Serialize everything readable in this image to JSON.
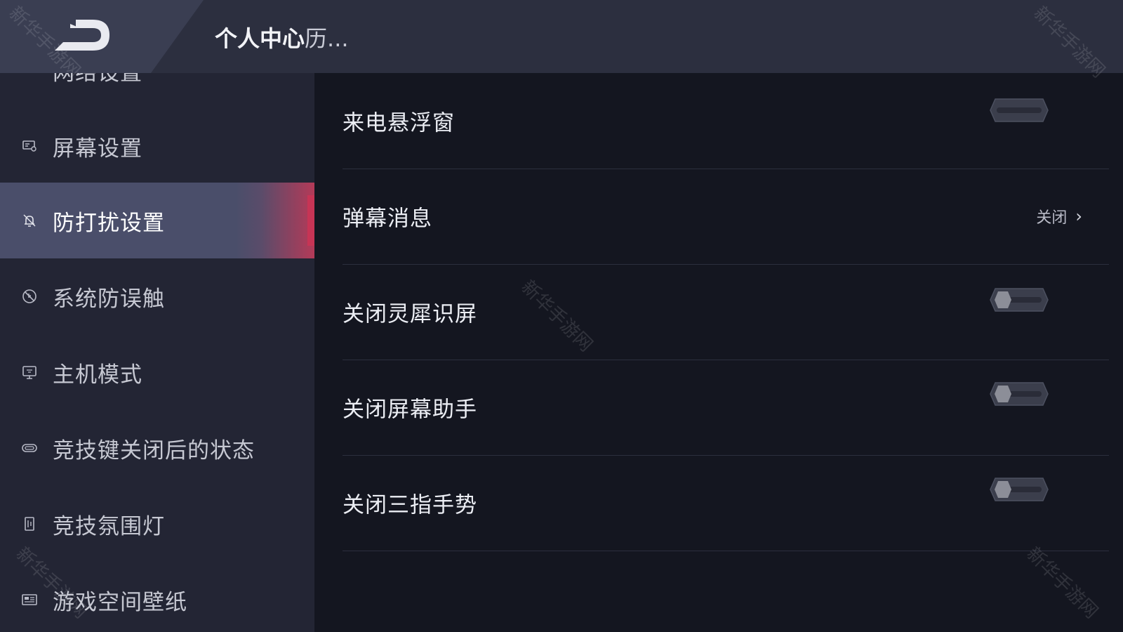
{
  "header": {
    "title_main": "个人中心",
    "title_sub": "历...",
    "back_icon": "back-arrow-icon"
  },
  "sidebar": {
    "items": [
      {
        "label": "网络设置",
        "icon": "network-icon"
      },
      {
        "label": "屏幕设置",
        "icon": "screen-settings-icon"
      },
      {
        "label": "防打扰设置",
        "icon": "bell-off-icon",
        "active": true
      },
      {
        "label": "系统防误触",
        "icon": "no-touch-icon"
      },
      {
        "label": "主机模式",
        "icon": "monitor-icon"
      },
      {
        "label": "竞技键关闭后的状态",
        "icon": "game-key-icon"
      },
      {
        "label": "竞技氛围灯",
        "icon": "light-icon"
      },
      {
        "label": "游戏空间壁纸",
        "icon": "wallpaper-icon"
      }
    ]
  },
  "settings": [
    {
      "label": "来电悬浮窗",
      "type": "toggle",
      "state": "off-no-knob"
    },
    {
      "label": "弹幕消息",
      "type": "link",
      "value": "关闭"
    },
    {
      "label": "关闭灵犀识屏",
      "type": "toggle",
      "state": "off"
    },
    {
      "label": "关闭屏幕助手",
      "type": "toggle",
      "state": "off"
    },
    {
      "label": "关闭三指手势",
      "type": "toggle",
      "state": "off"
    }
  ],
  "watermark": "新华手游网",
  "colors": {
    "accent": "#c73455",
    "sidebar_bg": "#232534",
    "content_bg": "#141620",
    "header_bg": "#2c2f3f"
  }
}
